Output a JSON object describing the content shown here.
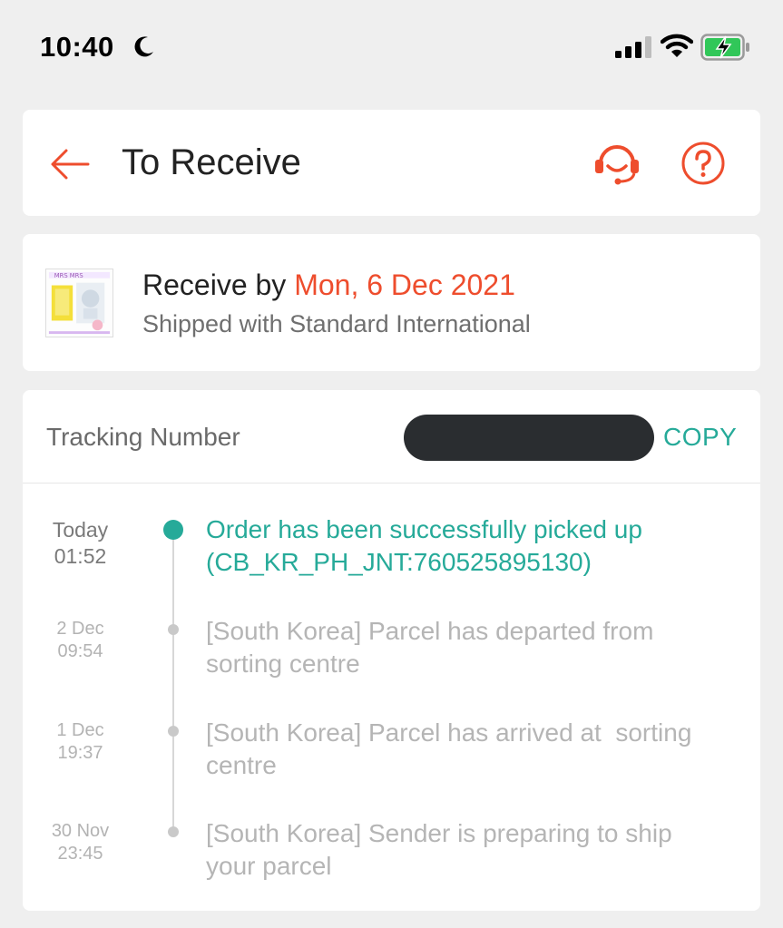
{
  "status_bar": {
    "time": "10:40"
  },
  "header": {
    "title": "To Receive",
    "back_icon": "arrow-left-icon",
    "support_icon": "headset-icon",
    "help_icon": "question-icon",
    "accent_color": "#ee4d2d"
  },
  "delivery": {
    "receive_prefix": "Receive by",
    "receive_date": "Mon, 6 Dec 2021",
    "shipping_method": "Shipped with Standard International",
    "thumb_text": "MRS MRS"
  },
  "tracking": {
    "label": "Tracking Number",
    "copy_label": "COPY",
    "teal_color": "#26aa99",
    "events": [
      {
        "date_line1": "Today",
        "date_line2": "01:52",
        "description_line1": "Order has been successfully picked up",
        "description_line2": "(CB_KR_PH_JNT:760525895130)"
      },
      {
        "date_line1": "2 Dec",
        "date_line2": "09:54",
        "description_line1": "[South Korea] Parcel has departed from",
        "description_line2": "sorting centre"
      },
      {
        "date_line1": "1 Dec",
        "date_line2": "19:37",
        "description_line1": "[South Korea] Parcel has arrived at  sorting",
        "description_line2": "centre"
      },
      {
        "date_line1": "30 Nov",
        "date_line2": "23:45",
        "description_line1": "[South Korea] Sender is preparing to ship",
        "description_line2": "your parcel"
      }
    ]
  }
}
